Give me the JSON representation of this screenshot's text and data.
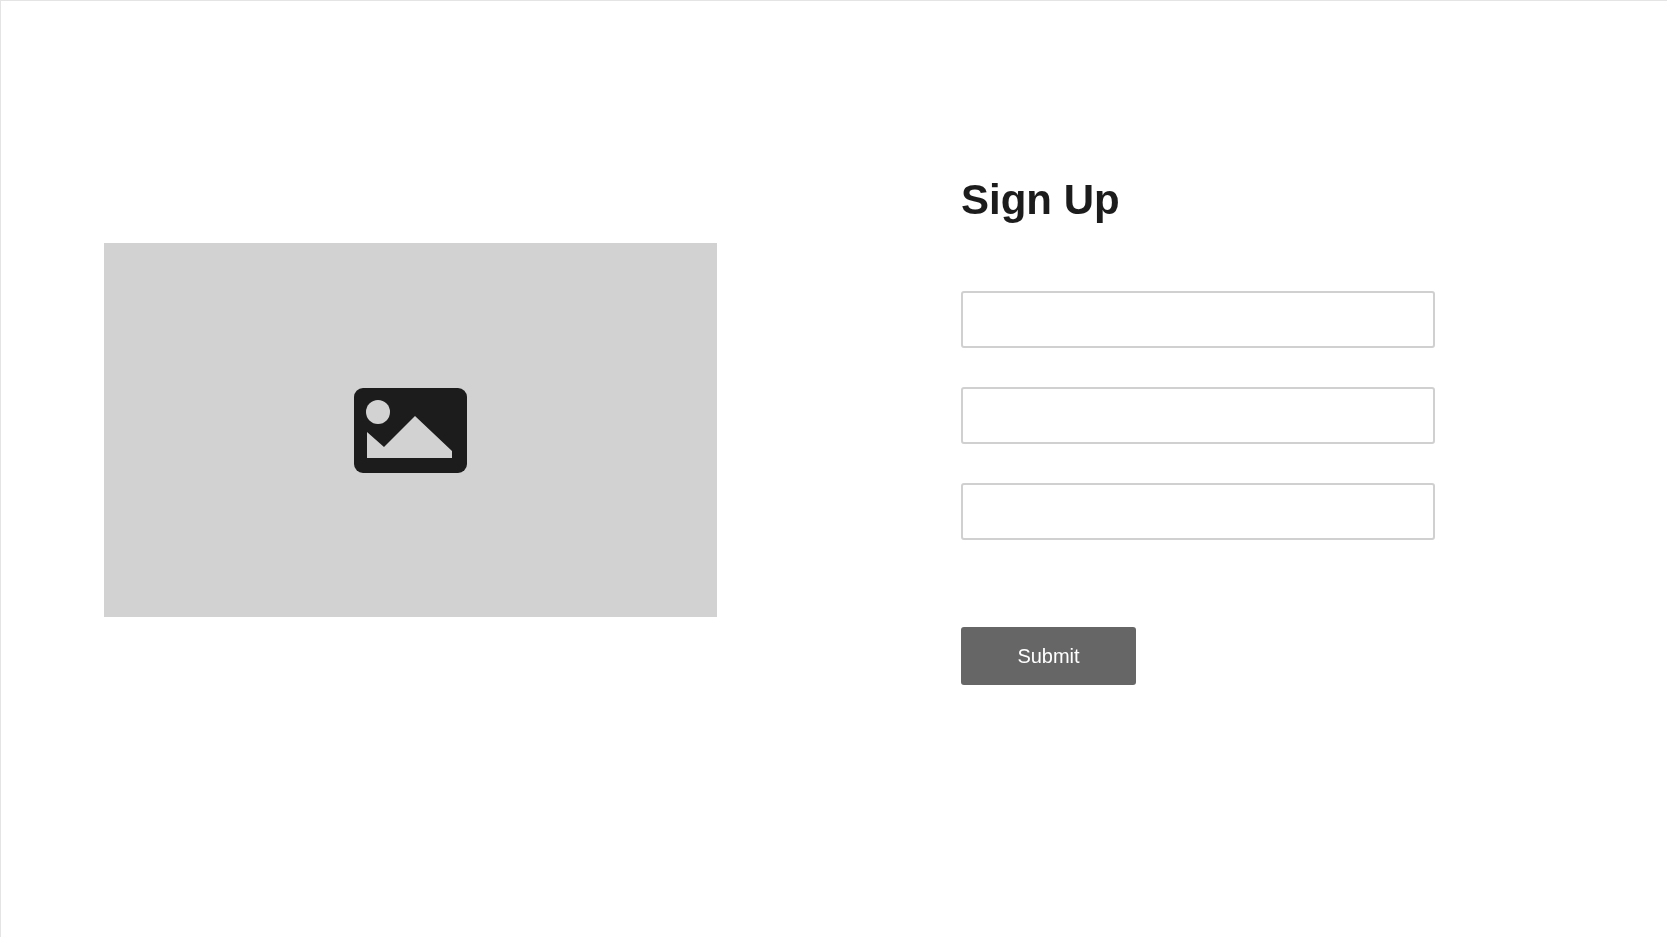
{
  "form": {
    "title": "Sign Up",
    "fields": [
      {
        "kind": "text"
      },
      {
        "kind": "text"
      },
      {
        "kind": "text"
      }
    ],
    "submit_button": "Submit"
  }
}
